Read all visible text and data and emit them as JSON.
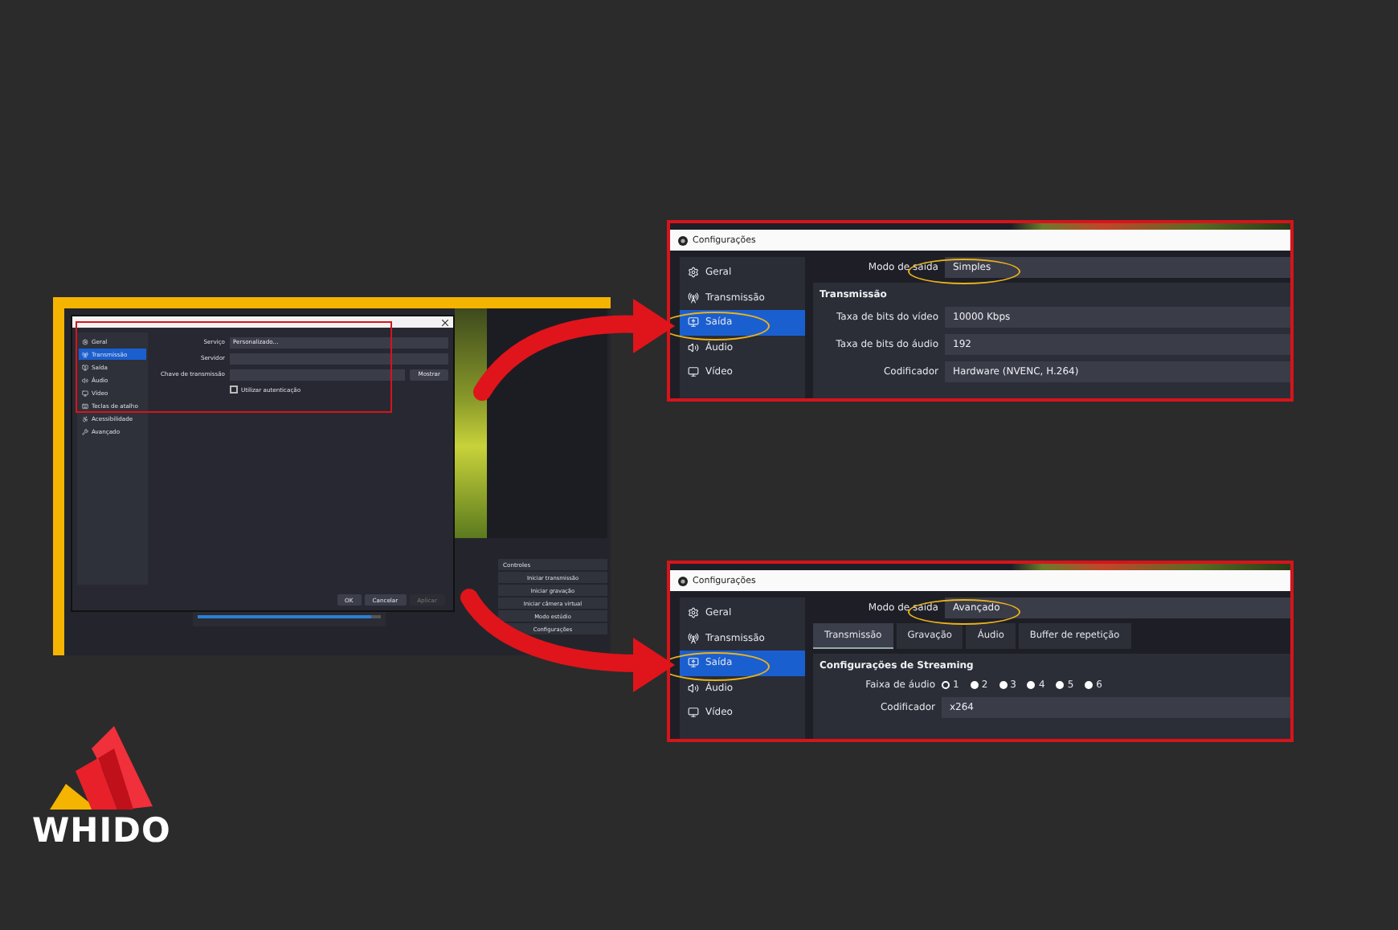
{
  "obs_window": {
    "sidebar": [
      {
        "label": "Geral",
        "selected": false
      },
      {
        "label": "Transmissão",
        "selected": true
      },
      {
        "label": "Saída",
        "selected": false
      },
      {
        "label": "Áudio",
        "selected": false
      },
      {
        "label": "Vídeo",
        "selected": false
      },
      {
        "label": "Teclas de atalho",
        "selected": false
      },
      {
        "label": "Acessibilidade",
        "selected": false
      },
      {
        "label": "Avançado",
        "selected": false
      }
    ],
    "service": {
      "label": "Serviço",
      "value": "Personalizado..."
    },
    "server": {
      "label": "Servidor"
    },
    "stream_key": {
      "label": "Chave de transmissão",
      "button": "Mostrar"
    },
    "auth": {
      "label": "Utilizar autenticação",
      "checked": false
    },
    "buttons": [
      {
        "label": "OK",
        "disabled": false
      },
      {
        "label": "Cancelar",
        "disabled": false
      },
      {
        "label": "Aplicar",
        "disabled": true
      }
    ],
    "mixer": {
      "level": 0.95
    },
    "controls": {
      "title": "Controles",
      "buttons": [
        "Iniciar transmissão",
        "Iniciar gravação",
        "Iniciar câmera virtual",
        "Modo estúdio",
        "Configurações"
      ]
    }
  },
  "settings_simple": {
    "title": "Configurações",
    "sidebar": [
      {
        "label": "Geral",
        "selected": false
      },
      {
        "label": "Transmissão",
        "selected": false
      },
      {
        "label": "Saída",
        "selected": true
      },
      {
        "label": "Áudio",
        "selected": false
      },
      {
        "label": "Vídeo",
        "selected": false
      }
    ],
    "output_mode": {
      "label": "Modo de saída",
      "value": "Simples"
    },
    "section_title": "Transmissão",
    "fields": [
      {
        "label": "Taxa de bits do vídeo",
        "value": "10000 Kbps"
      },
      {
        "label": "Taxa de bits do áudio",
        "value": "192"
      },
      {
        "label": "Codificador",
        "value": "Hardware (NVENC, H.264)"
      }
    ]
  },
  "settings_advanced": {
    "title": "Configurações",
    "sidebar": [
      {
        "label": "Geral",
        "selected": false
      },
      {
        "label": "Transmissão",
        "selected": false
      },
      {
        "label": "Saída",
        "selected": true
      },
      {
        "label": "Áudio",
        "selected": false
      },
      {
        "label": "Vídeo",
        "selected": false
      }
    ],
    "output_mode": {
      "label": "Modo de saída",
      "value": "Avançado"
    },
    "tabs": [
      {
        "label": "Transmissão",
        "selected": true
      },
      {
        "label": "Gravação",
        "selected": false
      },
      {
        "label": "Áudio",
        "selected": false
      },
      {
        "label": "Buffer de repetição",
        "selected": false
      }
    ],
    "section_title": "Configurações de Streaming",
    "audio_track": {
      "label": "Faixa de áudio",
      "options": [
        {
          "label": "1",
          "selected": true
        },
        {
          "label": "2",
          "selected": false
        },
        {
          "label": "3",
          "selected": false
        },
        {
          "label": "4",
          "selected": false
        },
        {
          "label": "5",
          "selected": false
        },
        {
          "label": "6",
          "selected": false
        }
      ]
    },
    "fields": [
      {
        "label": "Codificador",
        "value": "x264"
      }
    ]
  },
  "logo": {
    "text": "WHIDO"
  }
}
